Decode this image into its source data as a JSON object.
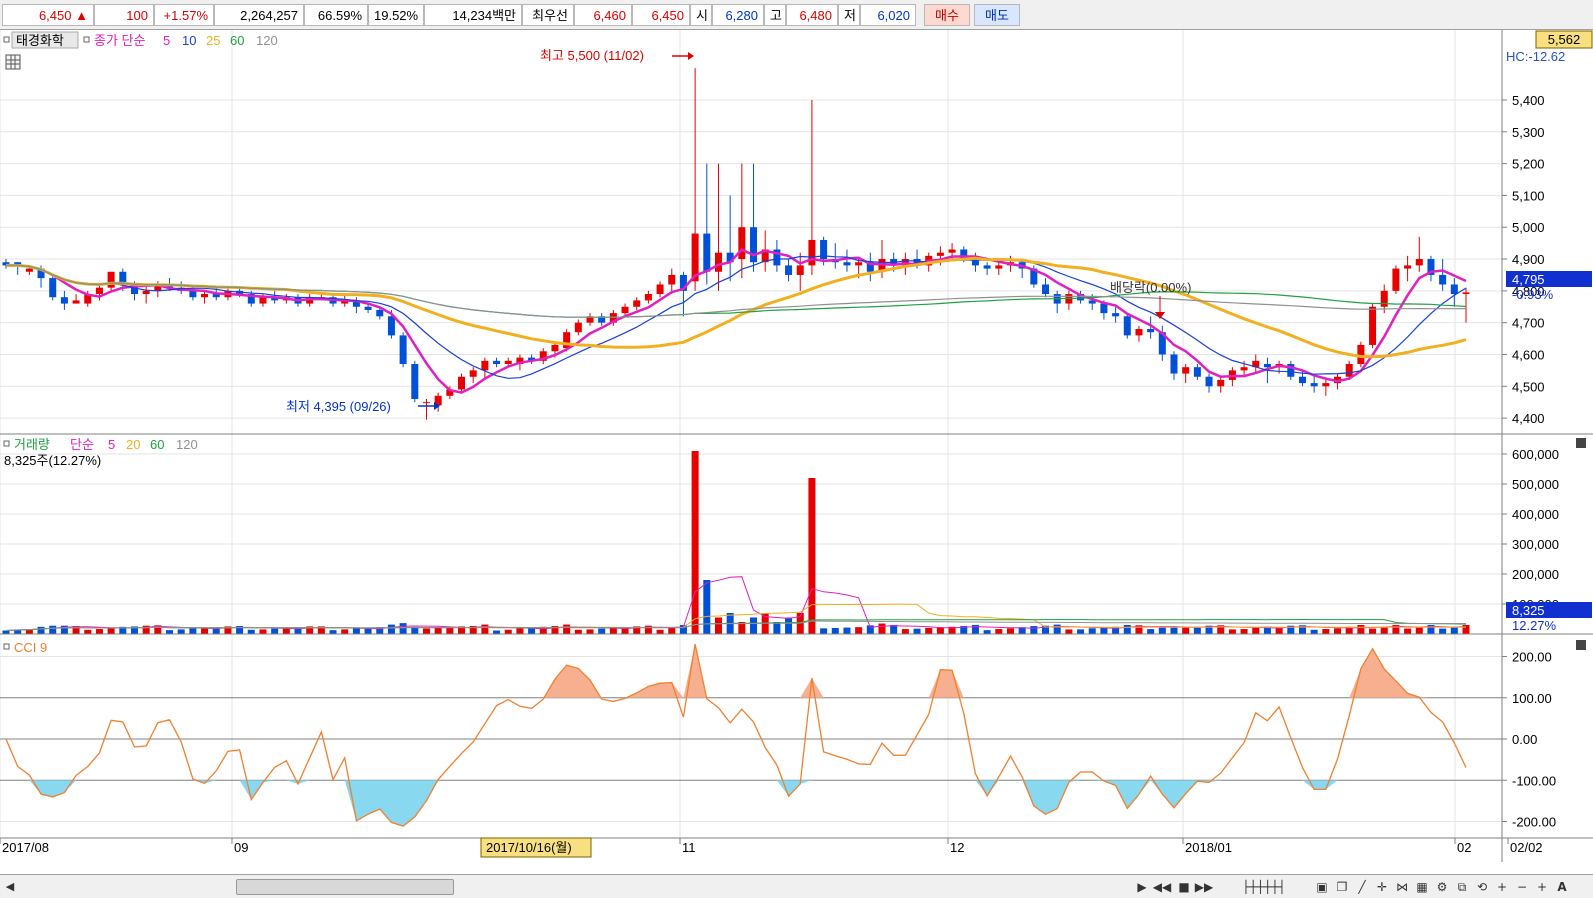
{
  "quote": {
    "price": "6,450",
    "up_arrow": "▲",
    "change": "100",
    "change_pct": "+1.57%",
    "volume": "2,264,257",
    "pct1": "66.59%",
    "pct2": "19.52%",
    "amount": "14,234백만",
    "best_label": "최우선",
    "best_ask": "6,460",
    "best_bid": "6,450",
    "open_label": "시",
    "open": "6,280",
    "high_label": "고",
    "high": "6,480",
    "low_label": "저",
    "low": "6,020",
    "buy_button": "매수",
    "sell_button": "매도"
  },
  "price_panel": {
    "stock_name": "태경화학",
    "ma_label": "종가 단순",
    "ma_periods": [
      "5",
      "10",
      "25",
      "60",
      "120"
    ],
    "high_annotation": "최고 5,500 (11/02)",
    "low_annotation": "최저 4,395 (09/26)",
    "dividend_annotation": "배당락(0.00%)",
    "top_box": "5,562",
    "hc_label": "HC:-12.62",
    "current_price_label": "4,795",
    "current_change_label": "-0.93%",
    "y_ticks": [
      "5,400",
      "5,300",
      "5,200",
      "5,100",
      "5,000",
      "4,900",
      "4,800",
      "4,700",
      "4,600",
      "4,500",
      "4,400"
    ]
  },
  "volume_panel": {
    "title": "거래량",
    "ma_label": "단순",
    "ma_periods": [
      "5",
      "20",
      "60",
      "120"
    ],
    "last_volume": "8,325주(12.27%)",
    "current_label": "8,325",
    "current_pct": "12.27%",
    "y_ticks": [
      "600,000",
      "500,000",
      "400,000",
      "300,000",
      "200,000",
      "100,000"
    ]
  },
  "cci_panel": {
    "title": "CCI 9",
    "y_ticks": [
      "200.00",
      "100.00",
      "0.00",
      "-100.00",
      "-200.00"
    ]
  },
  "x_axis": {
    "labels": [
      "2017/08",
      "09",
      "11",
      "12",
      "2018/01",
      "02",
      "02/02"
    ],
    "crosshair_date": "2017/10/16(월)"
  },
  "colors": {
    "up": "#e60000",
    "down": "#0050d8",
    "ma5": "#e020c0",
    "ma10": "#1840d8",
    "ma25": "#f0b020",
    "ma60": "#20a040",
    "ma120": "#909090",
    "cci_line": "#f08030",
    "cci_fill_pos": "#f6b090",
    "cci_fill_neg": "#88d8f0"
  },
  "chart_data": {
    "type": "candlestick",
    "candles_ohlc": [
      [
        4890,
        4900,
        4870,
        4880
      ],
      [
        4890,
        4890,
        4850,
        4880
      ],
      [
        4860,
        4880,
        4850,
        4870
      ],
      [
        4870,
        4880,
        4810,
        4840
      ],
      [
        4840,
        4850,
        4770,
        4780
      ],
      [
        4780,
        4800,
        4740,
        4760
      ],
      [
        4760,
        4790,
        4760,
        4770
      ],
      [
        4760,
        4800,
        4750,
        4790
      ],
      [
        4790,
        4820,
        4770,
        4810
      ],
      [
        4810,
        4860,
        4800,
        4860
      ],
      [
        4860,
        4870,
        4800,
        4820
      ],
      [
        4820,
        4830,
        4770,
        4790
      ],
      [
        4790,
        4820,
        4760,
        4800
      ],
      [
        4800,
        4830,
        4780,
        4820
      ],
      [
        4820,
        4840,
        4800,
        4810
      ],
      [
        4810,
        4830,
        4790,
        4800
      ],
      [
        4800,
        4820,
        4770,
        4780
      ],
      [
        4780,
        4800,
        4760,
        4790
      ],
      [
        4790,
        4810,
        4770,
        4780
      ],
      [
        4780,
        4810,
        4770,
        4800
      ],
      [
        4800,
        4810,
        4780,
        4790
      ],
      [
        4790,
        4800,
        4750,
        4760
      ],
      [
        4760,
        4790,
        4750,
        4780
      ],
      [
        4780,
        4800,
        4760,
        4770
      ],
      [
        4770,
        4790,
        4760,
        4780
      ],
      [
        4780,
        4790,
        4750,
        4760
      ],
      [
        4760,
        4790,
        4750,
        4780
      ],
      [
        4780,
        4790,
        4770,
        4780
      ],
      [
        4780,
        4790,
        4750,
        4760
      ],
      [
        4760,
        4790,
        4750,
        4770
      ],
      [
        4770,
        4780,
        4730,
        4750
      ],
      [
        4750,
        4760,
        4730,
        4740
      ],
      [
        4740,
        4750,
        4710,
        4720
      ],
      [
        4720,
        4740,
        4650,
        4660
      ],
      [
        4660,
        4670,
        4560,
        4570
      ],
      [
        4570,
        4580,
        4450,
        4460
      ],
      [
        4450,
        4460,
        4395,
        4450
      ],
      [
        4440,
        4480,
        4420,
        4470
      ],
      [
        4470,
        4500,
        4460,
        4490
      ],
      [
        4490,
        4540,
        4480,
        4530
      ],
      [
        4530,
        4560,
        4510,
        4550
      ],
      [
        4550,
        4590,
        4520,
        4580
      ],
      [
        4580,
        4590,
        4560,
        4570
      ],
      [
        4570,
        4590,
        4560,
        4580
      ],
      [
        4570,
        4600,
        4550,
        4590
      ],
      [
        4590,
        4600,
        4570,
        4580
      ],
      [
        4580,
        4620,
        4570,
        4610
      ],
      [
        4610,
        4640,
        4590,
        4630
      ],
      [
        4620,
        4680,
        4610,
        4670
      ],
      [
        4670,
        4710,
        4660,
        4700
      ],
      [
        4700,
        4730,
        4690,
        4720
      ],
      [
        4720,
        4730,
        4690,
        4700
      ],
      [
        4700,
        4740,
        4690,
        4730
      ],
      [
        4730,
        4760,
        4720,
        4750
      ],
      [
        4750,
        4780,
        4740,
        4770
      ],
      [
        4770,
        4800,
        4760,
        4790
      ],
      [
        4790,
        4830,
        4780,
        4820
      ],
      [
        4820,
        4870,
        4790,
        4850
      ],
      [
        4850,
        4860,
        4720,
        4800
      ],
      [
        4830,
        5500,
        4800,
        4980
      ],
      [
        4980,
        5200,
        4820,
        4860
      ],
      [
        4860,
        5200,
        4800,
        4920
      ],
      [
        4920,
        5100,
        4830,
        4890
      ],
      [
        4900,
        5200,
        4840,
        5000
      ],
      [
        5000,
        5200,
        4860,
        4890
      ],
      [
        4890,
        4990,
        4860,
        4930
      ],
      [
        4930,
        4960,
        4860,
        4880
      ],
      [
        4880,
        4900,
        4830,
        4850
      ],
      [
        4850,
        4920,
        4800,
        4880
      ],
      [
        4880,
        5400,
        4850,
        4960
      ],
      [
        4960,
        4970,
        4880,
        4900
      ],
      [
        4900,
        4950,
        4870,
        4890
      ],
      [
        4890,
        4930,
        4860,
        4880
      ],
      [
        4880,
        4900,
        4840,
        4890
      ],
      [
        4890,
        4920,
        4830,
        4860
      ],
      [
        4860,
        4960,
        4840,
        4900
      ],
      [
        4900,
        4920,
        4860,
        4880
      ],
      [
        4880,
        4920,
        4850,
        4900
      ],
      [
        4900,
        4930,
        4870,
        4880
      ],
      [
        4880,
        4920,
        4860,
        4910
      ],
      [
        4910,
        4940,
        4880,
        4920
      ],
      [
        4920,
        4950,
        4900,
        4930
      ],
      [
        4930,
        4940,
        4890,
        4900
      ],
      [
        4900,
        4920,
        4860,
        4880
      ],
      [
        4880,
        4890,
        4850,
        4870
      ],
      [
        4870,
        4900,
        4850,
        4880
      ],
      [
        4880,
        4910,
        4860,
        4890
      ],
      [
        4890,
        4900,
        4840,
        4870
      ],
      [
        4870,
        4880,
        4810,
        4820
      ],
      [
        4820,
        4840,
        4780,
        4790
      ],
      [
        4790,
        4800,
        4730,
        4760
      ],
      [
        4760,
        4800,
        4740,
        4790
      ],
      [
        4790,
        4800,
        4760,
        4770
      ],
      [
        4770,
        4790,
        4740,
        4760
      ],
      [
        4760,
        4770,
        4710,
        4730
      ],
      [
        4730,
        4750,
        4700,
        4720
      ],
      [
        4720,
        4730,
        4650,
        4660
      ],
      [
        4660,
        4690,
        4640,
        4680
      ],
      [
        4680,
        4720,
        4650,
        4670
      ],
      [
        4670,
        4690,
        4580,
        4600
      ],
      [
        4600,
        4610,
        4520,
        4540
      ],
      [
        4540,
        4570,
        4510,
        4560
      ],
      [
        4560,
        4570,
        4520,
        4530
      ],
      [
        4530,
        4540,
        4480,
        4500
      ],
      [
        4500,
        4530,
        4480,
        4520
      ],
      [
        4520,
        4560,
        4500,
        4550
      ],
      [
        4550,
        4580,
        4530,
        4560
      ],
      [
        4560,
        4600,
        4540,
        4580
      ],
      [
        4570,
        4590,
        4510,
        4560
      ],
      [
        4560,
        4580,
        4540,
        4570
      ],
      [
        4570,
        4580,
        4520,
        4530
      ],
      [
        4530,
        4550,
        4500,
        4510
      ],
      [
        4510,
        4530,
        4480,
        4500
      ],
      [
        4500,
        4520,
        4470,
        4510
      ],
      [
        4510,
        4540,
        4490,
        4530
      ],
      [
        4530,
        4580,
        4520,
        4570
      ],
      [
        4570,
        4640,
        4560,
        4630
      ],
      [
        4630,
        4760,
        4620,
        4750
      ],
      [
        4750,
        4820,
        4730,
        4800
      ],
      [
        4800,
        4880,
        4790,
        4870
      ],
      [
        4870,
        4910,
        4830,
        4880
      ],
      [
        4880,
        4970,
        4860,
        4900
      ],
      [
        4900,
        4910,
        4830,
        4850
      ],
      [
        4850,
        4900,
        4800,
        4820
      ],
      [
        4820,
        4840,
        4750,
        4790
      ],
      [
        4790,
        4810,
        4700,
        4795
      ]
    ],
    "x_range": [
      "2017/08",
      "2018/02"
    ],
    "ylim": [
      4350,
      5620
    ],
    "volume_ylim": [
      0,
      640000
    ],
    "cci_ylim": [
      -240,
      240
    ]
  }
}
